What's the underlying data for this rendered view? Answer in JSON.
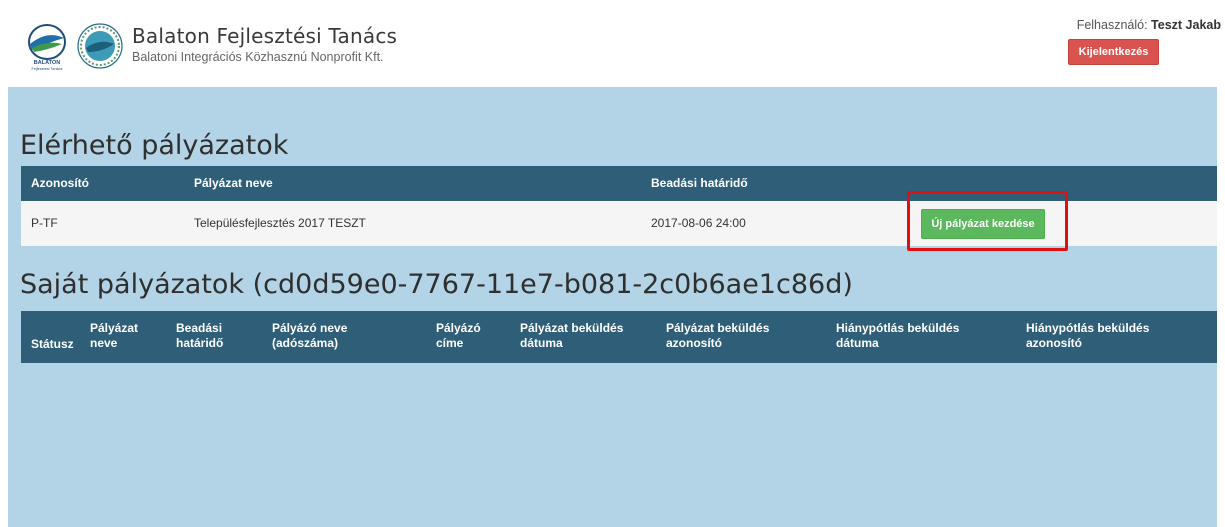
{
  "header": {
    "logo_text": "BALATON",
    "logo_sub": "Fejlesztési Tanács",
    "org_title": "Balaton Fejlesztési Tanács",
    "org_subtitle": "Balatoni Integrációs Közhasznú Nonprofit Kft.",
    "user_label": "Felhasználó:",
    "user_name": "Teszt Jakab",
    "logout_label": "Kijelentkezés"
  },
  "available": {
    "title": "Elérhető pályázatok",
    "columns": [
      "Azonosító",
      "Pályázat neve",
      "Beadási határidő"
    ],
    "rows": [
      {
        "id": "P-TF",
        "name": "Településfejlesztés 2017 TESZT",
        "deadline": "2017-08-06 24:00",
        "action": "Új pályázat kezdése"
      }
    ]
  },
  "own": {
    "title": "Saját pályázatok (cd0d59e0-7767-11e7-b081-2c0b6ae1c86d)",
    "columns": [
      "Státusz",
      "Pályázat\nneve",
      "Beadási\nhatáridő",
      "Pályázó neve\n(adószáma)",
      "Pályázó\ncíme",
      "Pályázat beküldés\ndátuma",
      "Pályázat beküldés\nazonosító",
      "Hiánypótlás beküldés\ndátuma",
      "Hiánypótlás beküldés\nazonosító"
    ]
  },
  "colors": {
    "page_bg": "#b3d4e6",
    "table_header": "#2e5e78",
    "logout": "#d9534f",
    "start": "#5cb85c",
    "highlight": "#e01010"
  }
}
